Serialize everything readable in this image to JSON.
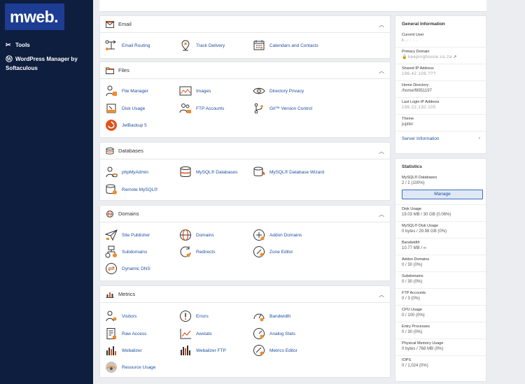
{
  "sidebar": {
    "logo": "mweb.",
    "items": [
      {
        "label": "Tools"
      },
      {
        "label": "WordPress Manager by"
      },
      {
        "label": "Softaculous"
      }
    ]
  },
  "sections": {
    "email": {
      "title": "Email",
      "items": [
        "Email Routing",
        "Track Delivery",
        "Calendars and Contacts"
      ]
    },
    "files": {
      "title": "Files",
      "items": [
        "File Manager",
        "Images",
        "Directory Privacy",
        "Disk Usage",
        "FTP Accounts",
        "Git™ Version Control",
        "JetBackup 5"
      ]
    },
    "databases": {
      "title": "Databases",
      "items": [
        "phpMyAdmin",
        "MySQL® Databases",
        "MySQL® Database Wizard",
        "Remote MySQL®"
      ]
    },
    "domains": {
      "title": "Domains",
      "items": [
        "Site Publisher",
        "Domains",
        "Addon Domains",
        "Subdomains",
        "Redirects",
        "Zone Editor",
        "Dynamic DNS"
      ]
    },
    "metrics": {
      "title": "Metrics",
      "items": [
        "Visitors",
        "Errors",
        "Bandwidth",
        "Raw Access",
        "Awstats",
        "Analog Stats",
        "Webalizer",
        "Webalizer FTP",
        "Metrics Editor",
        "Resource Usage"
      ]
    }
  },
  "general": {
    "title": "General Information",
    "current_user_label": "Current User",
    "current_user_value": "k... . . .",
    "primary_domain_label": "Primary Domain",
    "primary_domain_value": "keepinghouse.co.za",
    "shared_ip_label": "Shared IP Address",
    "shared_ip_value": "196.42.108.???",
    "home_dir_label": "Home Directory",
    "home_dir_value": "/home/f8951197",
    "last_login_label": "Last Login IP Address",
    "last_login_value": "196.22.130.105",
    "theme_label": "Theme",
    "theme_value": "jupiter",
    "server_info": "Server Information"
  },
  "stats": {
    "title": "Statistics",
    "mysql_label": "MySQL® Databases",
    "mysql_value": "2 / 2   (100%)",
    "manage": "Manage",
    "rows": [
      {
        "label": "Disk Usage",
        "value": "19.03 MB / 30 GB   (0.06%)"
      },
      {
        "label": "MySQL® Disk Usage",
        "value": "0 bytes / 29.98 GB   (0%)"
      },
      {
        "label": "Bandwidth",
        "value": "10.77 MB / ∞"
      },
      {
        "label": "Addon Domains",
        "value": "0 / 30   (0%)"
      },
      {
        "label": "Subdomains",
        "value": "0 / 30   (0%)"
      },
      {
        "label": "FTP Accounts",
        "value": "0 / 3   (0%)"
      },
      {
        "label": "CPU Usage",
        "value": "0 / 100   (0%)"
      },
      {
        "label": "Entry Processes",
        "value": "0 / 30   (0%)"
      },
      {
        "label": "Physical Memory Usage",
        "value": "0 bytes / 768 MB   (0%)"
      },
      {
        "label": "IOPS",
        "value": "0 / 1,024   (0%)"
      }
    ]
  },
  "colors": {
    "sidebar": "#0e1e3f",
    "logo_bg": "#1d3c93",
    "link": "#1c4e9c",
    "accent": "#f08c2a"
  }
}
